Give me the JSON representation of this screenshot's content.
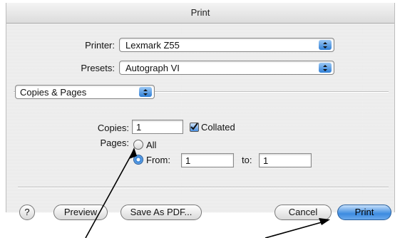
{
  "window": {
    "title": "Print"
  },
  "printer": {
    "label": "Printer:",
    "value": "Lexmark Z55"
  },
  "presets": {
    "label": "Presets:",
    "value": "Autograph VI"
  },
  "panel": {
    "value": "Copies & Pages"
  },
  "copies": {
    "label": "Copies:",
    "value": "1",
    "collated_label": "Collated",
    "collated_checked": true
  },
  "pages": {
    "label": "Pages:",
    "all_label": "All",
    "from_label": "From:",
    "from_value": "1",
    "to_label": "to:",
    "to_value": "1",
    "selected": "from"
  },
  "buttons": {
    "help": "?",
    "preview": "Preview",
    "save_pdf": "Save As PDF...",
    "cancel": "Cancel",
    "print": "Print"
  },
  "colors": {
    "accent": "#2f7fd6"
  }
}
